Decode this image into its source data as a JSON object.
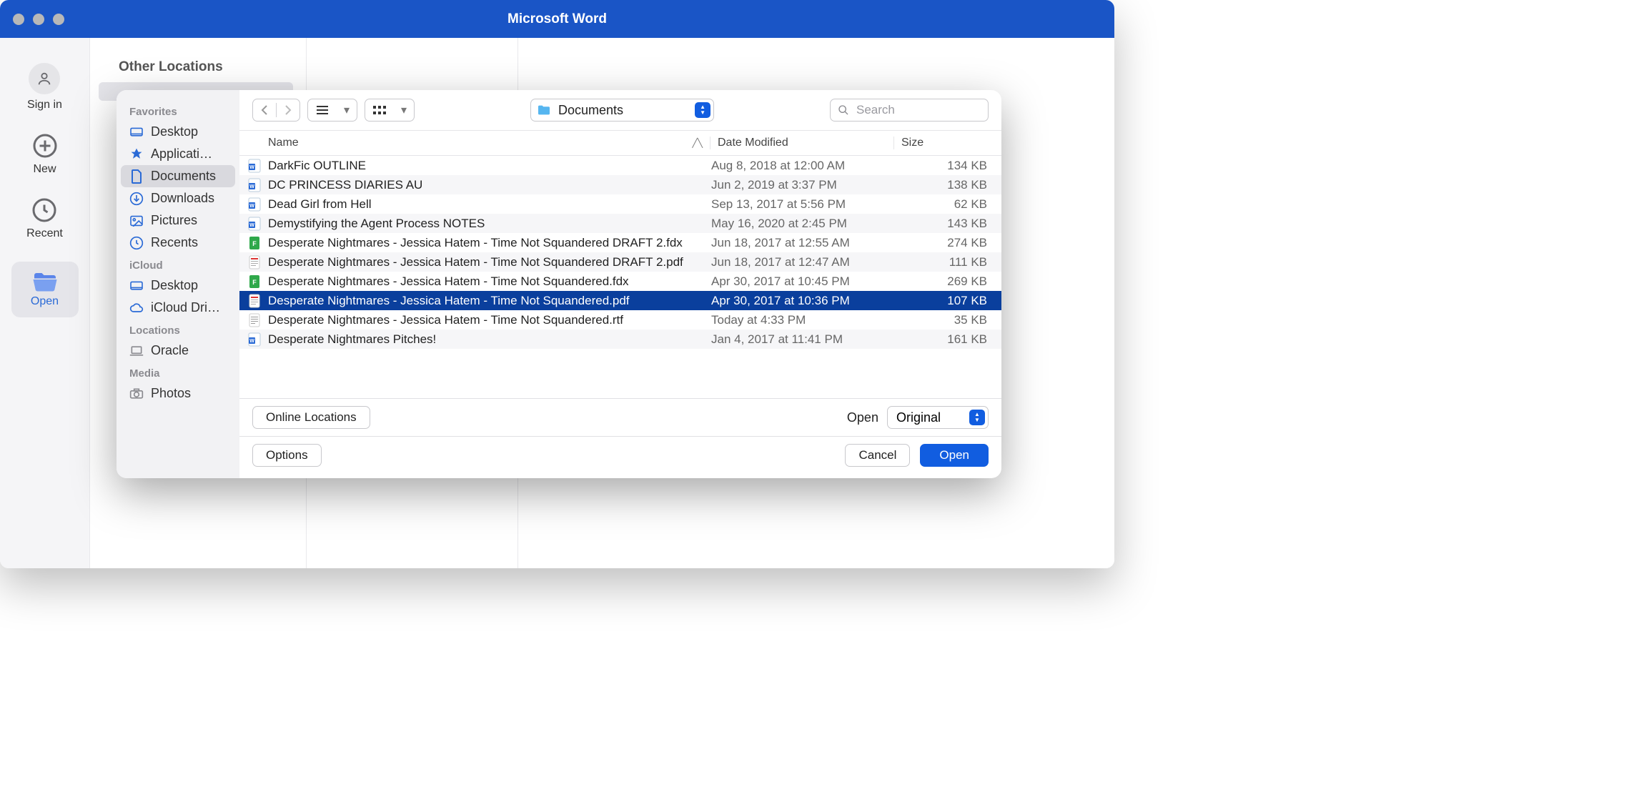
{
  "titlebar": {
    "title": "Microsoft Word"
  },
  "left_strip": {
    "sign_in": "Sign in",
    "new": "New",
    "recent": "Recent",
    "open": "Open"
  },
  "main": {
    "other_locations": "Other Locations"
  },
  "dialog": {
    "sidebar": {
      "favorites_head": "Favorites",
      "favorites": [
        {
          "label": "Desktop",
          "icon": "desktop"
        },
        {
          "label": "Applicati…",
          "icon": "apps"
        },
        {
          "label": "Documents",
          "icon": "doc",
          "selected": true
        },
        {
          "label": "Downloads",
          "icon": "downloads"
        },
        {
          "label": "Pictures",
          "icon": "pictures"
        },
        {
          "label": "Recents",
          "icon": "recents"
        }
      ],
      "icloud_head": "iCloud",
      "icloud": [
        {
          "label": "Desktop",
          "icon": "desktop"
        },
        {
          "label": "iCloud Dri…",
          "icon": "cloud"
        }
      ],
      "locations_head": "Locations",
      "locations": [
        {
          "label": "Oracle",
          "icon": "laptop"
        }
      ],
      "media_head": "Media",
      "media": [
        {
          "label": "Photos",
          "icon": "camera"
        }
      ]
    },
    "toolbar": {
      "location": "Documents",
      "search_placeholder": "Search"
    },
    "columns": {
      "name": "Name",
      "date": "Date Modified",
      "size": "Size"
    },
    "files": [
      {
        "icon": "word",
        "name": "DarkFic OUTLINE",
        "date": "Aug 8, 2018 at 12:00 AM",
        "size": "134 KB"
      },
      {
        "icon": "word",
        "name": "DC PRINCESS DIARIES AU",
        "date": "Jun 2, 2019 at 3:37 PM",
        "size": "138 KB"
      },
      {
        "icon": "word",
        "name": "Dead Girl from Hell",
        "date": "Sep 13, 2017 at 5:56 PM",
        "size": "62 KB"
      },
      {
        "icon": "word",
        "name": "Demystifying the Agent Process NOTES",
        "date": "May 16, 2020 at 2:45 PM",
        "size": "143 KB"
      },
      {
        "icon": "fdx",
        "name": "Desperate Nightmares - Jessica Hatem - Time Not Squandered DRAFT 2.fdx",
        "date": "Jun 18, 2017 at 12:55 AM",
        "size": "274 KB"
      },
      {
        "icon": "pdf",
        "name": "Desperate Nightmares - Jessica Hatem - Time Not Squandered DRAFT 2.pdf",
        "date": "Jun 18, 2017 at 12:47 AM",
        "size": "111 KB"
      },
      {
        "icon": "fdx",
        "name": "Desperate Nightmares - Jessica Hatem - Time Not Squandered.fdx",
        "date": "Apr 30, 2017 at 10:45 PM",
        "size": "269 KB"
      },
      {
        "icon": "pdf",
        "name": "Desperate Nightmares - Jessica Hatem - Time Not Squandered.pdf",
        "date": "Apr 30, 2017 at 10:36 PM",
        "size": "107 KB",
        "selected": true
      },
      {
        "icon": "rtf",
        "name": "Desperate Nightmares - Jessica Hatem - Time Not Squandered.rtf",
        "date": "Today at 4:33 PM",
        "size": "35 KB"
      },
      {
        "icon": "word",
        "name": "Desperate Nightmares Pitches!",
        "date": "Jan 4, 2017 at 11:41 PM",
        "size": "161 KB"
      }
    ],
    "options_row": {
      "online_locations": "Online Locations",
      "open_label": "Open",
      "open_mode": "Original"
    },
    "footer": {
      "options": "Options",
      "cancel": "Cancel",
      "open": "Open"
    }
  }
}
